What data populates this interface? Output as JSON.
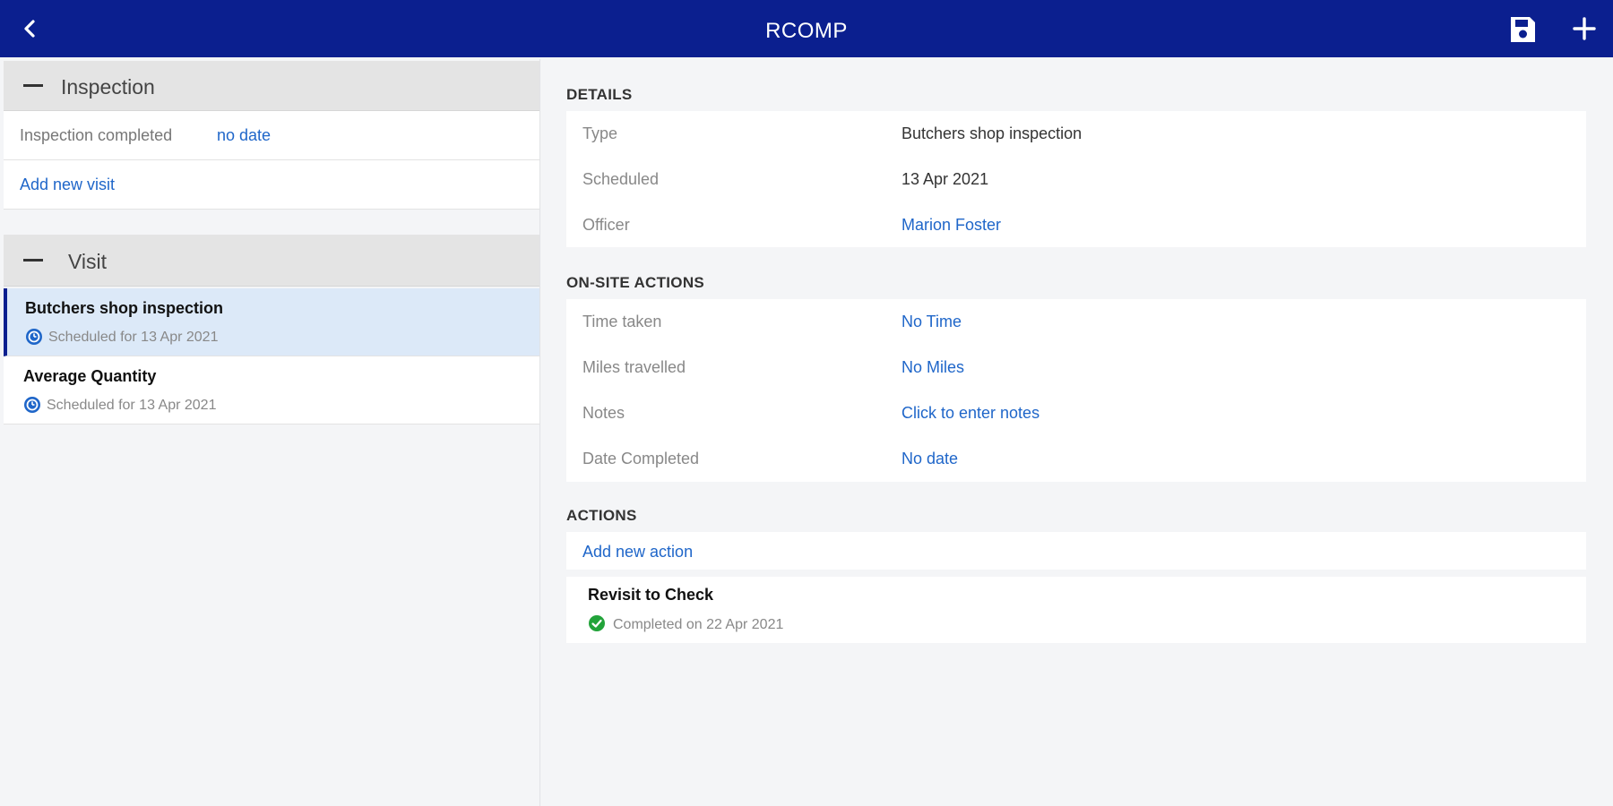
{
  "header": {
    "title": "RCOMP",
    "back_icon": "chevron-left-icon",
    "save_icon": "save-icon",
    "add_icon": "plus-icon"
  },
  "left": {
    "inspection": {
      "heading": "Inspection",
      "completed_label": "Inspection completed",
      "completed_value": "no date",
      "add_visit": "Add new visit"
    },
    "visit": {
      "heading": "Visit",
      "items": [
        {
          "name": "Butchers shop inspection",
          "status": "Scheduled for 13 Apr 2021",
          "selected": true
        },
        {
          "name": "Average Quantity",
          "status": "Scheduled for 13 Apr 2021",
          "selected": false
        }
      ]
    }
  },
  "details": {
    "title": "DETAILS",
    "fields": [
      {
        "label": "Type",
        "value": "Butchers shop inspection"
      },
      {
        "label": "Scheduled",
        "value": "13 Apr 2021"
      },
      {
        "label": "Officer",
        "value": "Marion Foster"
      }
    ]
  },
  "onsite": {
    "title": "ON-SITE ACTIONS",
    "fields": [
      {
        "label": "Time taken",
        "value": "No Time"
      },
      {
        "label": "Miles travelled",
        "value": "No Miles"
      },
      {
        "label": "Notes",
        "value": "Click to enter notes"
      },
      {
        "label": "Date Completed",
        "value": "No date"
      }
    ]
  },
  "actions": {
    "title": "ACTIONS",
    "add": "Add new action",
    "items": [
      {
        "name": "Revisit to Check",
        "status": "Completed on 22 Apr 2021"
      }
    ]
  },
  "colors": {
    "brand": "#0b1f8f",
    "link": "#1f66c9",
    "scheduled": "#1f66c9",
    "completed": "#22a33a"
  }
}
